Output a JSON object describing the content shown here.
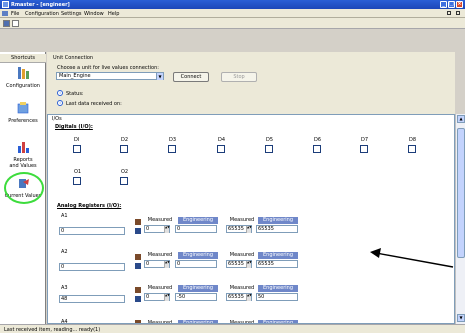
{
  "window": {
    "title": "Rmaster - [engineer]"
  },
  "menu": {
    "items": [
      "File",
      "Configuration",
      "Settings",
      "Window",
      "Help"
    ]
  },
  "sidebar": {
    "header": "Shortcuts",
    "items": [
      {
        "label": "Configuration",
        "icon": "configuration-icon"
      },
      {
        "label": "Preferences",
        "icon": "preferences-icon"
      },
      {
        "label": "Reports and Values",
        "icon": "reports-icon"
      },
      {
        "label": "Current Values",
        "icon": "current-values-icon"
      }
    ]
  },
  "connection": {
    "title": "Unit Connection",
    "prompt": "Choose a unit for live values connection:",
    "selected_unit": "Main_Engine",
    "connect_label": "Connect",
    "stop_label": "Stop",
    "status_label": "Status:",
    "last_data_label": "Last data received on:"
  },
  "io": {
    "title": "I/Os",
    "digitals_title": "Digitals (I/O):",
    "digital_inputs": [
      "DI",
      "D2",
      "D3",
      "D4",
      "D5",
      "D6",
      "D7",
      "D8"
    ],
    "digital_outputs": [
      "O1",
      "O2"
    ],
    "analogs_title": "Analog Registers (I/O):",
    "measured_label": "Measured",
    "engineering_label": "Engineering",
    "analogs": [
      {
        "name": "A1",
        "value": "0",
        "min_measured": "0",
        "min_engineering": "0",
        "max_measured": "65535",
        "max_engineering": "65535"
      },
      {
        "name": "A2",
        "value": "0",
        "min_measured": "0",
        "min_engineering": "0",
        "max_measured": "65535",
        "max_engineering": "65535"
      },
      {
        "name": "A3",
        "value": "48",
        "min_measured": "0",
        "min_engineering": "-50",
        "max_measured": "65535",
        "max_engineering": "50"
      },
      {
        "name": "A4",
        "value": "",
        "min_measured": "",
        "min_engineering": "",
        "max_measured": "",
        "max_engineering": ""
      }
    ]
  },
  "status_bar": {
    "text": "Last received item, reading... ready(1)"
  },
  "colors": {
    "highlight_circle": "#3ddc3d",
    "title_bar": "#1c47b8",
    "engineering_tag": "#6f87c9"
  }
}
